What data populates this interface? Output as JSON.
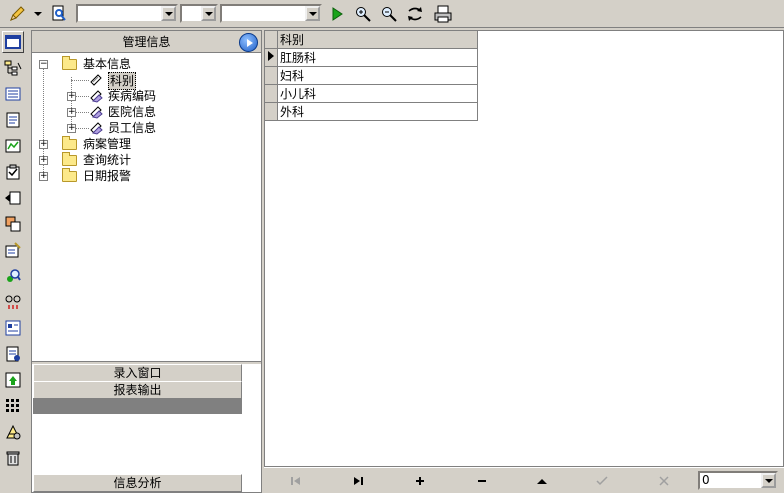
{
  "panel": {
    "title": "管理信息"
  },
  "tree": {
    "root_basic": "基本信息",
    "item_dept": "科别",
    "item_disease": "疾病编码",
    "item_hospital": "医院信息",
    "item_staff": "员工信息",
    "root_records": "病案管理",
    "root_query": "查询统计",
    "root_alarm": "日期报警"
  },
  "sections": {
    "entry_window": "录入窗口",
    "report_output": "报表输出",
    "info_analysis": "信息分析"
  },
  "grid": {
    "column_header": "科别",
    "rows": [
      "肛肠科",
      "妇科",
      "小儿科",
      "外科"
    ]
  },
  "db_navigator": {
    "record_select_value": "0"
  },
  "colors": {
    "window_bg": "#d4d0c8",
    "accent_blue": "#1f5fc8"
  }
}
